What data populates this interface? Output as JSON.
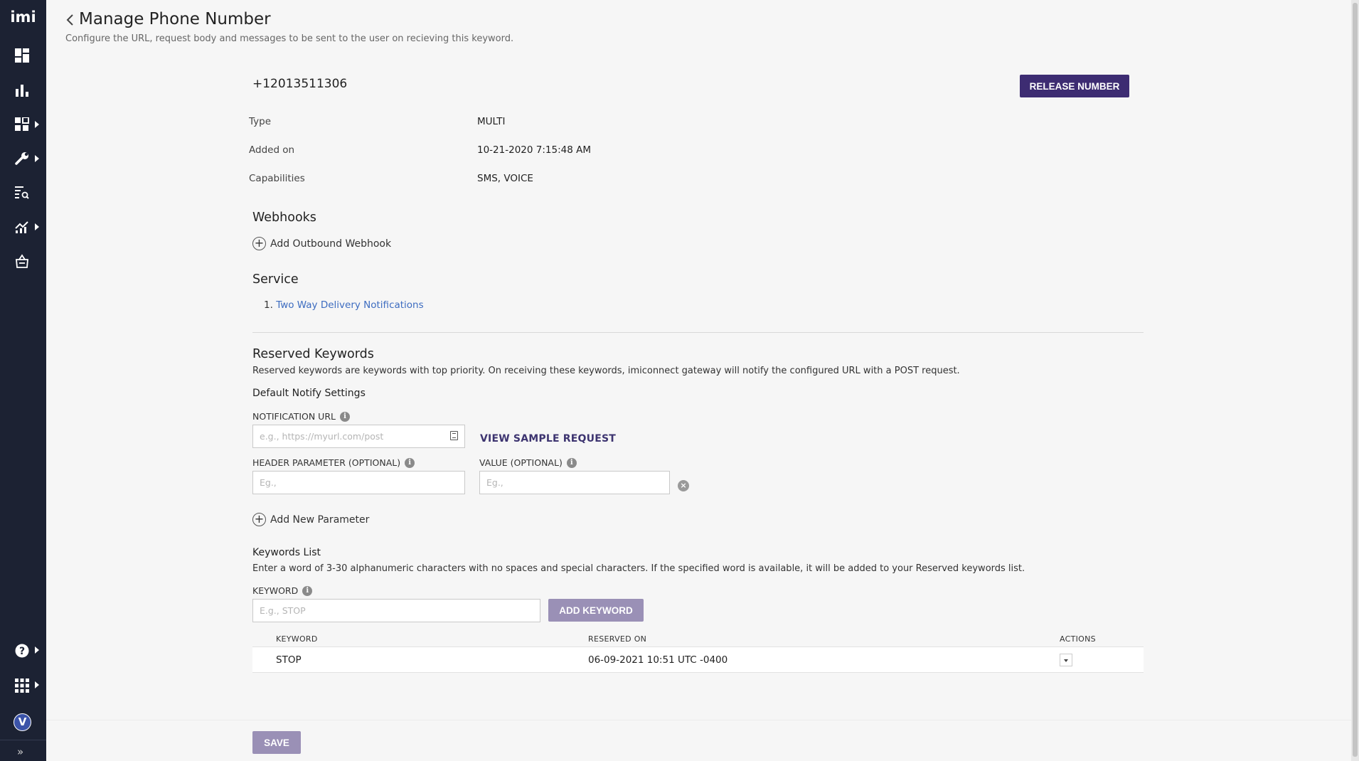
{
  "sidebar": {
    "logo": "imi",
    "items": [
      {
        "icon": "dashboard-icon",
        "has_arrow": false
      },
      {
        "icon": "bar-chart-icon",
        "has_arrow": false
      },
      {
        "icon": "apps-grid-icon",
        "has_arrow": true
      },
      {
        "icon": "wrench-icon",
        "has_arrow": true
      },
      {
        "icon": "logs-search-icon",
        "has_arrow": false
      },
      {
        "icon": "trend-chart-icon",
        "has_arrow": true
      },
      {
        "icon": "shopping-bag-icon",
        "has_arrow": false
      }
    ],
    "help_icon": "help-icon",
    "apps_icon": "apps-launcher-icon",
    "avatar_initial": "V",
    "expand_label": "»"
  },
  "header": {
    "title": "Manage Phone Number",
    "subtitle": "Configure the URL, request body and messages to be sent to the user on recieving this keyword."
  },
  "number": {
    "phone": "+12013511306",
    "release_label": "RELEASE NUMBER",
    "details": [
      {
        "label": "Type",
        "value": "MULTI"
      },
      {
        "label": "Added on",
        "value": "10-21-2020 7:15:48 AM"
      },
      {
        "label": "Capabilities",
        "value": "SMS, VOICE"
      }
    ]
  },
  "webhooks": {
    "title": "Webhooks",
    "add_label": "Add Outbound Webhook"
  },
  "service": {
    "title": "Service",
    "items": [
      {
        "index": "1.",
        "name": "Two Way Delivery Notifications"
      }
    ]
  },
  "reserved": {
    "title": "Reserved Keywords",
    "description": "Reserved keywords are keywords with top priority. On receiving these keywords, imiconnect gateway will notify the configured URL with a POST request.",
    "default_settings": "Default Notify Settings",
    "notification_url_label": "NOTIFICATION URL",
    "notification_url_placeholder": "e.g., https://myurl.com/post",
    "view_sample": "VIEW SAMPLE REQUEST",
    "header_param_label": "HEADER PARAMETER (OPTIONAL)",
    "header_param_placeholder": "Eg.,",
    "value_label": "VALUE (OPTIONAL)",
    "value_placeholder": "Eg.,",
    "add_param_label": "Add New Parameter"
  },
  "keywords": {
    "title": "Keywords List",
    "description": "Enter a word of 3-30 alphanumeric characters with no spaces and special characters. If the specified word is available, it will be added to your Reserved keywords list.",
    "keyword_label": "KEYWORD",
    "keyword_placeholder": "E.g., STOP",
    "add_label": "ADD KEYWORD",
    "columns": [
      "KEYWORD",
      "RESERVED ON",
      "ACTIONS"
    ],
    "rows": [
      {
        "keyword": "STOP",
        "reserved_on": "06-09-2021 10:51 UTC -0400"
      }
    ]
  },
  "footer": {
    "save_label": "SAVE"
  }
}
